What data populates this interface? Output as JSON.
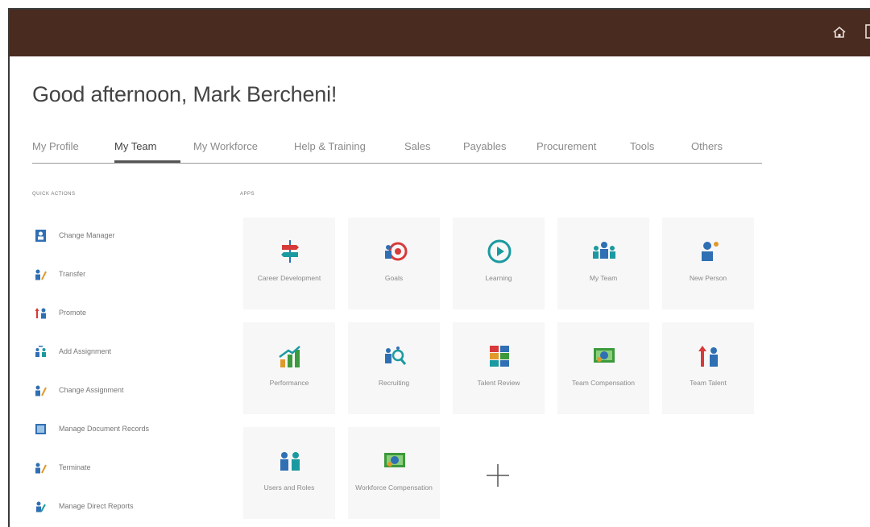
{
  "header": {
    "greeting": "Good afternoon, Mark Bercheni!"
  },
  "tabs": [
    {
      "label": "My Profile"
    },
    {
      "label": "My Team",
      "active": true
    },
    {
      "label": "My Workforce"
    },
    {
      "label": "Help & Training"
    },
    {
      "label": "Sales"
    },
    {
      "label": "Payables"
    },
    {
      "label": "Procurement"
    },
    {
      "label": "Tools"
    },
    {
      "label": "Others"
    }
  ],
  "quick_actions": {
    "label": "QUICK ACTIONS",
    "items": [
      {
        "label": "Change Manager",
        "icon": "change-manager-icon"
      },
      {
        "label": "Transfer",
        "icon": "transfer-icon"
      },
      {
        "label": "Promote",
        "icon": "promote-icon"
      },
      {
        "label": "Add Assignment",
        "icon": "add-assignment-icon"
      },
      {
        "label": "Change Assignment",
        "icon": "change-assignment-icon"
      },
      {
        "label": "Manage Document Records",
        "icon": "document-records-icon"
      },
      {
        "label": "Terminate",
        "icon": "terminate-icon"
      },
      {
        "label": "Manage Direct Reports",
        "icon": "direct-reports-icon"
      }
    ]
  },
  "apps": {
    "label": "APPS",
    "tiles": [
      {
        "label": "Career Development",
        "icon": "signpost-icon"
      },
      {
        "label": "Goals",
        "icon": "target-icon"
      },
      {
        "label": "Learning",
        "icon": "play-circle-icon"
      },
      {
        "label": "My Team",
        "icon": "team-icon"
      },
      {
        "label": "New Person",
        "icon": "new-person-icon"
      },
      {
        "label": "Performance",
        "icon": "bar-chart-icon"
      },
      {
        "label": "Recruiting",
        "icon": "recruiting-icon"
      },
      {
        "label": "Talent Review",
        "icon": "talent-grid-icon"
      },
      {
        "label": "Team Compensation",
        "icon": "money-icon"
      },
      {
        "label": "Team Talent",
        "icon": "team-talent-icon"
      },
      {
        "label": "Users and Roles",
        "icon": "users-roles-icon"
      },
      {
        "label": "Workforce Compensation",
        "icon": "money-icon"
      }
    ],
    "add_label": "+"
  },
  "colors": {
    "header_bg": "#4a2b20",
    "teal": "#1a9aa0",
    "blue": "#2f6fb3",
    "red": "#d63a3a",
    "green": "#3c9a3c",
    "orange": "#e09a2c"
  }
}
